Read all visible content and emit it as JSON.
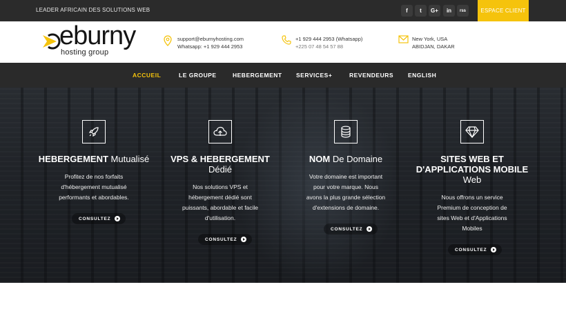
{
  "topbar": {
    "tagline": "LEADER AFRICAIN DES SOLUTIONS WEB",
    "social": [
      {
        "icon": "facebook-icon",
        "label": "f"
      },
      {
        "icon": "twitter-icon",
        "label": "t"
      },
      {
        "icon": "google-plus-icon",
        "label": "G+"
      },
      {
        "icon": "linkedin-icon",
        "label": "in"
      },
      {
        "icon": "rss-icon",
        "label": "rss"
      }
    ],
    "client_button": "ESPACE CLIENT",
    "accent_color": "#f5c30c"
  },
  "header": {
    "logo_word": "eburny",
    "logo_sub": "hosting group",
    "contacts": [
      {
        "icon": "location-pin-icon",
        "line1": "support@eburnyhosting.com",
        "line2": "Whatsapp: +1 929 444 2953"
      },
      {
        "icon": "phone-icon",
        "line1": "+1 929 444 2953 (Whatsapp)",
        "line2": "+225 07 48 54 57 88"
      },
      {
        "icon": "envelope-icon",
        "line1": "New York, USA",
        "line2": "ABIDJAN, DAKAR"
      }
    ]
  },
  "nav": {
    "items": [
      "ACCUEIL",
      "LE GROUPE",
      "HEBERGEMENT",
      "SERVICES+",
      "REVENDEURS",
      "ENGLISH"
    ],
    "active": "ACCUEIL"
  },
  "services": [
    {
      "icon": "rocket-icon",
      "title_bold": "HEBERGEMENT",
      "title_light": "Mutualisé",
      "desc": [
        "Profitez de nos forfaits",
        "d'hébergement mutualisé",
        "performants et abordables."
      ],
      "button": "CONSULTEZ"
    },
    {
      "icon": "cloud-upload-icon",
      "title_bold": "VPS & HEBERGEMENT",
      "title_light": "Dédié",
      "desc": [
        "Nos solutions VPS et",
        "hébergement dédié sont",
        "puissants, abordable et facile",
        "d'utilisation."
      ],
      "button": "CONSULTEZ"
    },
    {
      "icon": "database-icon",
      "title_bold": "NOM",
      "title_light": "De Domaine",
      "desc": [
        "Votre domaine est important",
        "pour votre marque. Nous",
        "avons la plus grande sélection",
        "d'extensions de domaine."
      ],
      "button": "CONSULTEZ"
    },
    {
      "icon": "diamond-icon",
      "title_bold": "SITES WEB ET",
      "title_bold2": "D'APPLICATIONS MOBILE",
      "title_light": "Web",
      "desc": [
        "Nous offrons un service",
        "Premium de conception de",
        "sites Web et d'Applications",
        "Mobiles"
      ],
      "button": "CONSULTEZ"
    }
  ]
}
